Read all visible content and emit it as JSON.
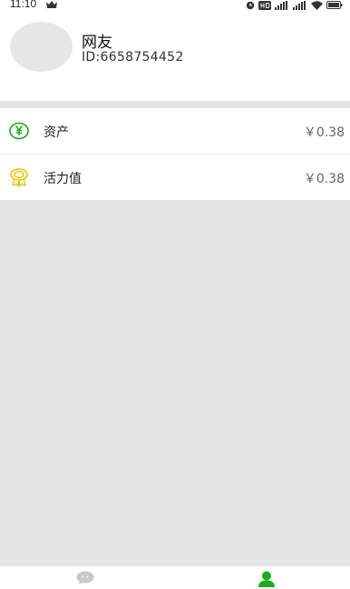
{
  "status_bar": {
    "time": "11:10"
  },
  "profile": {
    "nickname": "网友",
    "id_text": "ID:6658754452"
  },
  "list": {
    "items": [
      {
        "label": "资产",
        "value": "￥0.38",
        "icon": "yuan-circle-icon",
        "color": "#1aad19"
      },
      {
        "label": "活力值",
        "value": "￥0.38",
        "icon": "medal-icon",
        "color": "#f2c200"
      }
    ]
  },
  "bottom_nav": {
    "items": [
      {
        "icon": "chat-bubble-icon",
        "active": false
      },
      {
        "icon": "person-icon",
        "active": true
      }
    ],
    "active_color": "#1aad19",
    "inactive_color": "#c8c8c8"
  }
}
